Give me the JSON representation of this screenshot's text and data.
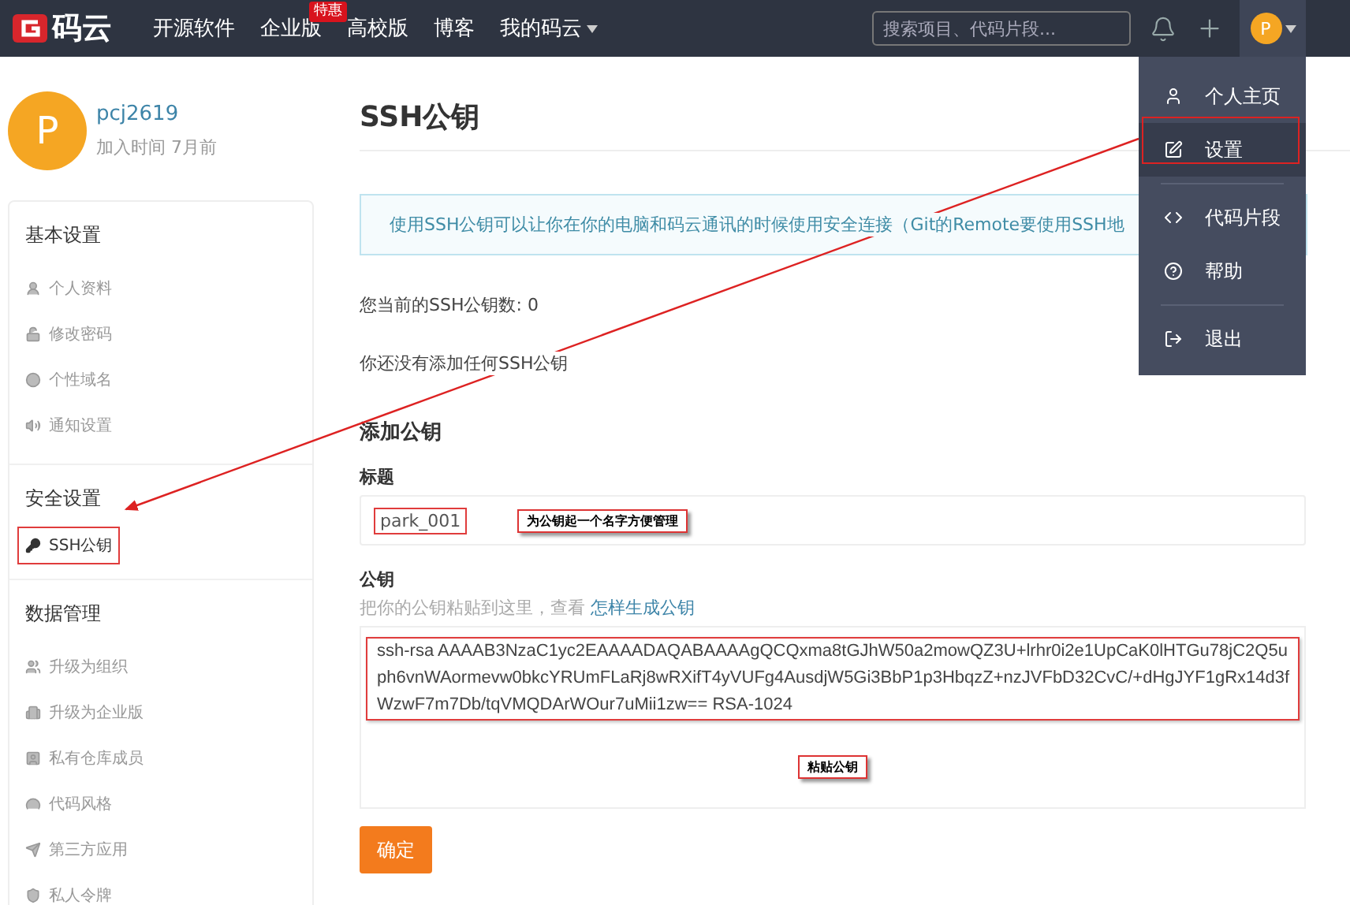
{
  "navbar": {
    "logo_text": "码云",
    "links": [
      {
        "label": "开源软件"
      },
      {
        "label": "企业版",
        "badge": "特惠"
      },
      {
        "label": "高校版"
      },
      {
        "label": "博客"
      },
      {
        "label": "我的码云",
        "dropdown": true
      }
    ],
    "search": {
      "placeholder": "搜索项目、代码片段..."
    },
    "avatar": "P"
  },
  "user_menu": {
    "groups": [
      [
        {
          "label": "个人主页",
          "selected": false
        },
        {
          "label": "设置",
          "selected": true
        }
      ],
      [
        {
          "label": "代码片段",
          "selected": false
        },
        {
          "label": "帮助",
          "selected": false
        }
      ],
      [
        {
          "label": "退出",
          "selected": false
        }
      ]
    ]
  },
  "profile": {
    "avatar": "P",
    "name": "pcj2619",
    "joined": "加入时间 7月前"
  },
  "sidebar": {
    "sections": [
      {
        "title": "基本设置",
        "items": [
          {
            "label": "个人资料",
            "selected": false
          },
          {
            "label": "修改密码",
            "selected": false
          },
          {
            "label": "个性域名",
            "selected": false
          },
          {
            "label": "通知设置",
            "selected": false
          }
        ]
      },
      {
        "title": "安全设置",
        "items": [
          {
            "label": "SSH公钥",
            "selected": true
          }
        ]
      },
      {
        "title": "数据管理",
        "items": [
          {
            "label": "升级为组织",
            "selected": false
          },
          {
            "label": "升级为企业版",
            "selected": false
          },
          {
            "label": "私有仓库成员",
            "selected": false
          },
          {
            "label": "代码风格",
            "selected": false
          },
          {
            "label": "第三方应用",
            "selected": false
          },
          {
            "label": "私人令牌",
            "selected": false
          }
        ]
      }
    ]
  },
  "main": {
    "title": "SSH公钥",
    "info": "使用SSH公钥可以让你在你的电脑和码云通讯的时候使用安全连接（Git的Remote要使用SSH地",
    "count_text": "您当前的SSH公钥数: 0",
    "empty_text": "你还没有添加任何SSH公钥",
    "add_title": "添加公钥",
    "title_label": "标题",
    "title_value": "park_001",
    "key_label": "公钥",
    "key_hint": "把你的公钥粘贴到这里，查看",
    "key_hint_link": "怎样生成公钥",
    "key_value": "ssh-rsa AAAAB3NzaC1yc2EAAAADAQABAAAAgQCQxma8tGJhW50a2mowQZ3U+lrhr0i2e1UpCaK0lHTGu78jC2Q5uph6vnWAormevw0bkcYRUmFLaRj8wRXifT4yVUFg4AusdjW5Gi3BbP1p3HbqzZ+nzJVFbD32CvC/+dHgJYF1gRx14d3fWzwF7m7Db/tqVMQDArWOur7uMii1zw== RSA-1024",
    "submit": "确定"
  },
  "annotations": {
    "title_note": "为公钥起一个名字方便管理",
    "key_note": "粘贴公钥"
  }
}
